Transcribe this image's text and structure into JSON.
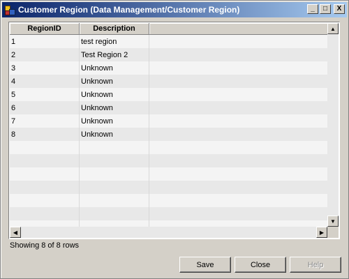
{
  "window": {
    "title": "Customer Region (Data Management/Customer Region)",
    "controls": {
      "minimize": "_",
      "maximize": "□",
      "close": "X"
    }
  },
  "grid": {
    "columns": [
      "RegionID",
      "Description",
      ""
    ],
    "rows": [
      {
        "id": "1",
        "description": "test region"
      },
      {
        "id": "2",
        "description": "Test Region 2"
      },
      {
        "id": "3",
        "description": "Unknown"
      },
      {
        "id": "4",
        "description": "Unknown"
      },
      {
        "id": "5",
        "description": "Unknown"
      },
      {
        "id": "6",
        "description": "Unknown"
      },
      {
        "id": "7",
        "description": "Unknown"
      },
      {
        "id": "8",
        "description": "Unknown"
      }
    ],
    "empty_rows": 7
  },
  "scrollbars": {
    "up": "▲",
    "down": "▼",
    "left": "◀",
    "right": "▶"
  },
  "status": {
    "text": "Showing 8 of 8 rows"
  },
  "buttons": {
    "save": "Save",
    "close": "Close",
    "help": "Help"
  }
}
